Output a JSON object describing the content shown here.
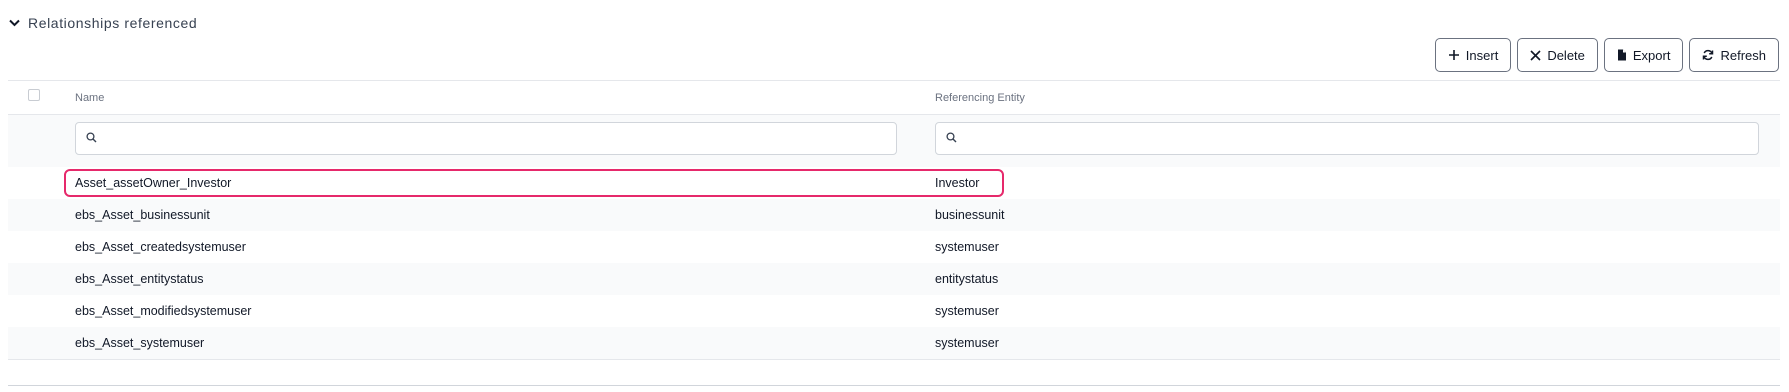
{
  "section": {
    "title": "Relationships referenced",
    "icon": "chevron-down-icon"
  },
  "toolbar": {
    "insert_label": "Insert",
    "delete_label": "Delete",
    "export_label": "Export",
    "refresh_label": "Refresh"
  },
  "table": {
    "columns": [
      "Name",
      "Referencing Entity"
    ],
    "filters": {
      "name_placeholder": "",
      "ref_placeholder": ""
    },
    "rows": [
      {
        "name": "Asset_assetOwner_Investor",
        "ref": "Investor",
        "highlighted": true
      },
      {
        "name": "ebs_Asset_businessunit",
        "ref": "businessunit"
      },
      {
        "name": "ebs_Asset_createdsystemuser",
        "ref": "systemuser"
      },
      {
        "name": "ebs_Asset_entitystatus",
        "ref": "entitystatus"
      },
      {
        "name": "ebs_Asset_modifiedsystemuser",
        "ref": "systemuser"
      },
      {
        "name": "ebs_Asset_systemuser",
        "ref": "systemuser"
      }
    ]
  },
  "colors": {
    "highlight": "#e6296b",
    "alt_row": "#f9fafb"
  }
}
